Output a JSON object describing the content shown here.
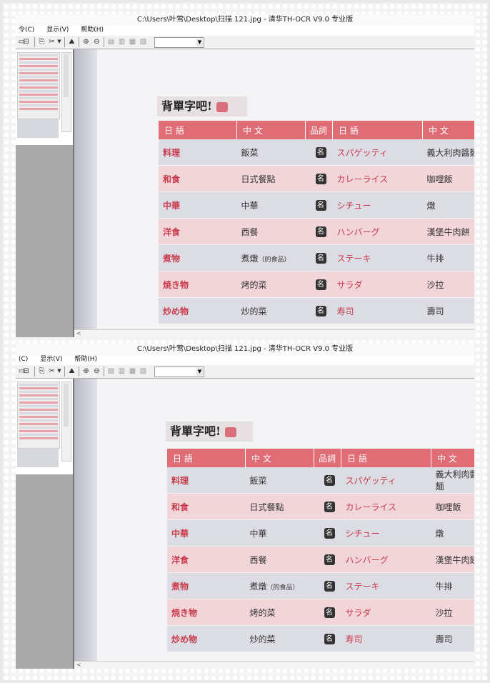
{
  "window": {
    "title": "C:\\Users\\叶莺\\Desktop\\扫描 121.jpg - 清华TH-OCR V9.0 专业版"
  },
  "menu": [
    {
      "label": "令(C)"
    },
    {
      "label": "显示(V)"
    },
    {
      "label": "帮助(H)"
    }
  ],
  "menu2": [
    {
      "label": "(C)"
    },
    {
      "label": "显示(V)"
    },
    {
      "label": "帮助(H)"
    }
  ],
  "toolbar": {
    "icons": [
      "open-icon",
      "copy-icon",
      "cut-icon",
      "dropdown-icon",
      "scan-icon",
      "zoom-in-icon",
      "zoom-out-icon",
      "layout-1-icon",
      "layout-2-icon",
      "layout-3-icon",
      "layout-4-icon"
    ],
    "zoom_combo_value": ""
  },
  "document": {
    "banner": "背單字吧!",
    "headers": {
      "jp1": "日 語",
      "zh1": "中 文",
      "pos": "品詞",
      "jp2": "日 語",
      "zh2": "中 文"
    },
    "rows": [
      {
        "jp1": "料理",
        "zh1": "飯菜",
        "pos": "名",
        "jp2": "スパゲッティ",
        "zh2": "義大利肉醬麵"
      },
      {
        "jp1": "和食",
        "zh1": "日式餐點",
        "pos": "名",
        "jp2": "カレーライス",
        "zh2": "咖哩飯"
      },
      {
        "jp1": "中華",
        "zh1": "中華",
        "pos": "名",
        "jp2": "シチュー",
        "zh2": "燉"
      },
      {
        "jp1": "洋食",
        "zh1": "西餐",
        "pos": "名",
        "jp2": "ハンバーグ",
        "zh2": "漢堡牛肉餅"
      },
      {
        "jp1": "煮物",
        "zh1": "煮燉",
        "zh1_note": "（的食品）",
        "pos": "名",
        "jp2": "ステーキ",
        "zh2": "牛排"
      },
      {
        "jp1": "焼き物",
        "zh1": "烤的菜",
        "pos": "名",
        "jp2": "サラダ",
        "zh2": "沙拉"
      },
      {
        "jp1": "炒め物",
        "zh1": "炒的菜",
        "pos": "名",
        "jp2": "寿司",
        "zh2": "壽司"
      }
    ]
  },
  "scrollbar": {
    "left_arrow": "<"
  }
}
